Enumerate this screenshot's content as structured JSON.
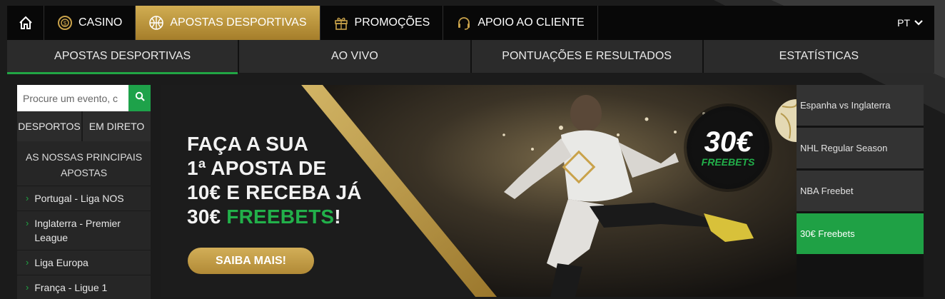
{
  "topnav": {
    "items": [
      {
        "label": "CASINO",
        "icon": "casino-chip-icon"
      },
      {
        "label": "APOSTAS DESPORTIVAS",
        "icon": "basketball-icon"
      },
      {
        "label": "PROMOÇÕES",
        "icon": "gift-icon"
      },
      {
        "label": "APOIO AO CLIENTE",
        "icon": "headset-icon"
      }
    ],
    "language": "PT",
    "accent": "#c39b41"
  },
  "subnav": {
    "tabs": [
      "APOSTAS DESPORTIVAS",
      "AO VIVO",
      "PONTUAÇÕES E RESULTADOS",
      "ESTATÍSTICAS"
    ],
    "active_color": "#21a644"
  },
  "sidebar": {
    "search_placeholder": "Procure um evento, c",
    "tabs": [
      "DESPORTOS",
      "EM DIRETO"
    ],
    "heading": "AS NOSSAS PRINCIPAIS APOSTAS",
    "items": [
      "Portugal - Liga NOS",
      "Inglaterra - Premier League",
      "Liga Europa",
      "França - Ligue 1"
    ]
  },
  "banner": {
    "line1": "FAÇA A SUA",
    "line2": "1ª APOSTA DE",
    "line3": "10€ E RECEBA JÁ",
    "line4_prefix": "30€ ",
    "line4_green": "FREEBETS",
    "line4_suffix": "!",
    "cta": "SAIBA MAIS!",
    "badge_amount": "30€",
    "badge_label": "FREEBETS"
  },
  "promos": [
    "Espanha vs Inglaterra",
    "NHL Regular Season",
    "NBA Freebet",
    "30€ Freebets"
  ]
}
